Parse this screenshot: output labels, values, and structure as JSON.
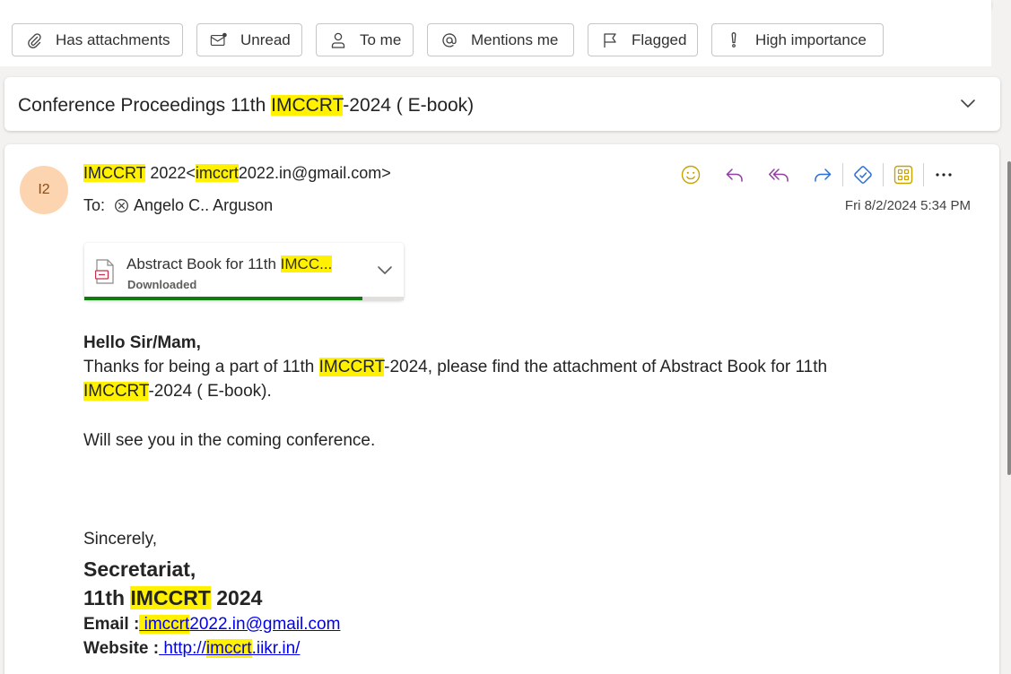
{
  "filters": [
    {
      "label": "Has attachments",
      "icon": "paperclip-icon"
    },
    {
      "label": "Unread",
      "icon": "envelope-unread-icon"
    },
    {
      "label": "To me",
      "icon": "person-icon"
    },
    {
      "label": "Mentions me",
      "icon": "at-icon"
    },
    {
      "label": "Flagged",
      "icon": "flag-icon"
    },
    {
      "label": "High importance",
      "icon": "exclamation-icon"
    }
  ],
  "subject": {
    "pre": "Conference Proceedings 11th ",
    "highlight": "IMCCRT",
    "post": "-2024 ( E-book)"
  },
  "message": {
    "avatar_initials": "I2",
    "sender_hl1": "IMCCRT",
    "sender_mid": " 2022<",
    "sender_hl2": "imccrt",
    "sender_post": "2022.in@gmail.com>",
    "to_label": "To:",
    "recipient": "Angelo C.. Arguson",
    "date": "Fri 8/2/2024 5:34 PM"
  },
  "attachment": {
    "name_pre": "Abstract Book for 11th ",
    "name_hl": "IMCC...",
    "status": "Downloaded",
    "progress": 0.87
  },
  "body": {
    "greeting": "Hello Sir/Mam,",
    "line1_pre": "Thanks for being a part of 11th ",
    "line1_hl": "IMCCRT",
    "line1_post": "-2024, please find the attachment of Abstract Book for 11th",
    "line2_hl": "IMCCRT",
    "line2_post": "-2024 ( E-book).",
    "line3": "Will see you in the coming conference.",
    "closing": "Sincerely,",
    "sig_name": "Secretariat,",
    "sig_org_pre": "11th ",
    "sig_org_hl": "IMCCRT",
    "sig_org_post": " 2024",
    "email_label": "Email :",
    "email_space": " ",
    "email_hl": "imccrt",
    "email_post": "2022.in@gmail.com",
    "website_label": "Website :",
    "website_pre": " http://",
    "website_hl": "imccrt",
    "website_post": ".iikr.in/"
  },
  "colors": {
    "highlight": "#fff100",
    "avatar_bg": "#fcd5b0",
    "progress": "#107c10",
    "link": "#0000ee"
  }
}
